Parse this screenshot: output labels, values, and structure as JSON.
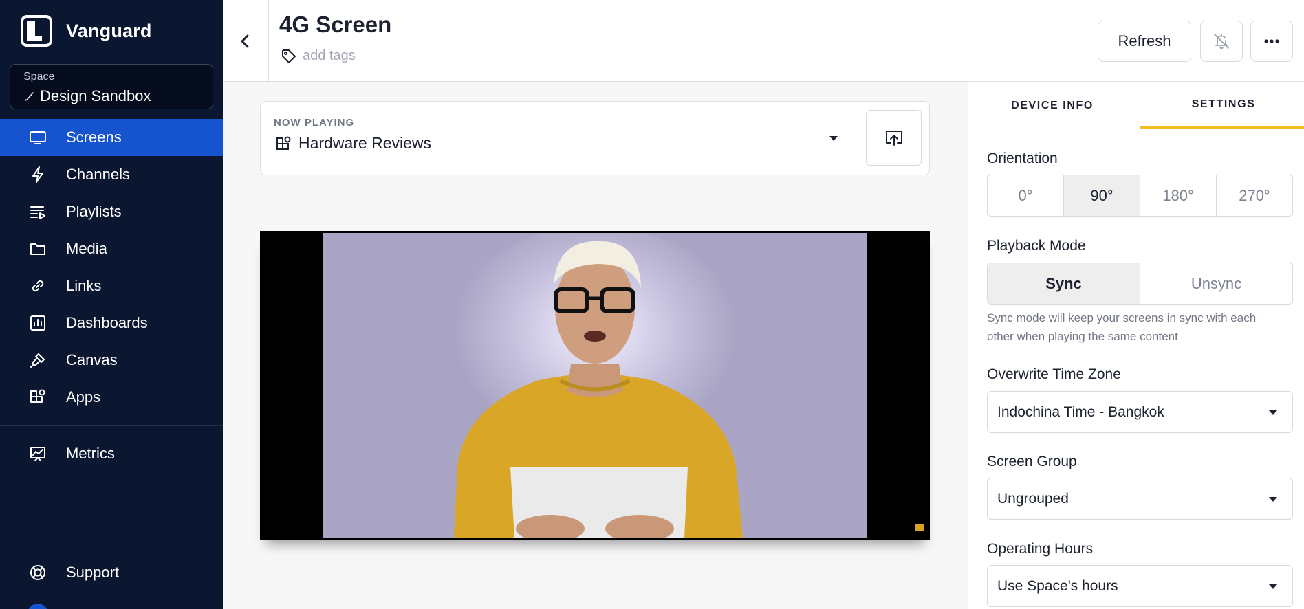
{
  "app": {
    "name": "Vanguard"
  },
  "space": {
    "label": "Space",
    "name": "Design Sandbox",
    "icon": "brush-icon"
  },
  "nav": {
    "items": [
      {
        "label": "Screens",
        "icon": "screen-icon",
        "active": true
      },
      {
        "label": "Channels",
        "icon": "lightning-icon"
      },
      {
        "label": "Playlists",
        "icon": "playlist-icon"
      },
      {
        "label": "Media",
        "icon": "folder-icon"
      },
      {
        "label": "Links",
        "icon": "link-icon"
      },
      {
        "label": "Dashboards",
        "icon": "dashboard-icon"
      },
      {
        "label": "Canvas",
        "icon": "brush-icon"
      },
      {
        "label": "Apps",
        "icon": "apps-icon"
      }
    ],
    "metrics": {
      "label": "Metrics",
      "icon": "metrics-icon"
    },
    "support": {
      "label": "Support",
      "icon": "lifebuoy-icon"
    }
  },
  "header": {
    "title": "4G Screen",
    "tags_placeholder": "add tags",
    "refresh_label": "Refresh",
    "bell_icon": "bell-off-icon",
    "more_icon": "more-icon"
  },
  "now_playing": {
    "label": "NOW PLAYING",
    "value": "Hardware Reviews",
    "icon": "apps-icon",
    "cast_icon": "cast-icon"
  },
  "preview": {
    "image": "presenter-video-frame"
  },
  "panel": {
    "tabs": [
      {
        "label": "DEVICE INFO",
        "active": false
      },
      {
        "label": "SETTINGS",
        "active": true
      }
    ],
    "orientation": {
      "label": "Orientation",
      "options": [
        "0°",
        "90°",
        "180°",
        "270°"
      ],
      "selected": "90°"
    },
    "playback": {
      "label": "Playback Mode",
      "options": [
        "Sync",
        "Unsync"
      ],
      "selected": "Sync",
      "help": "Sync mode will keep your screens in sync with each other when playing the same content"
    },
    "timezone": {
      "label": "Overwrite Time Zone",
      "value": "Indochina Time - Bangkok"
    },
    "screen_group": {
      "label": "Screen Group",
      "value": "Ungrouped"
    },
    "operating_hours": {
      "label": "Operating Hours",
      "value": "Use Space's hours"
    }
  },
  "colors": {
    "sidebar_bg": "#0b1731",
    "active_nav": "#1653cf",
    "tab_accent": "#f2be22"
  }
}
